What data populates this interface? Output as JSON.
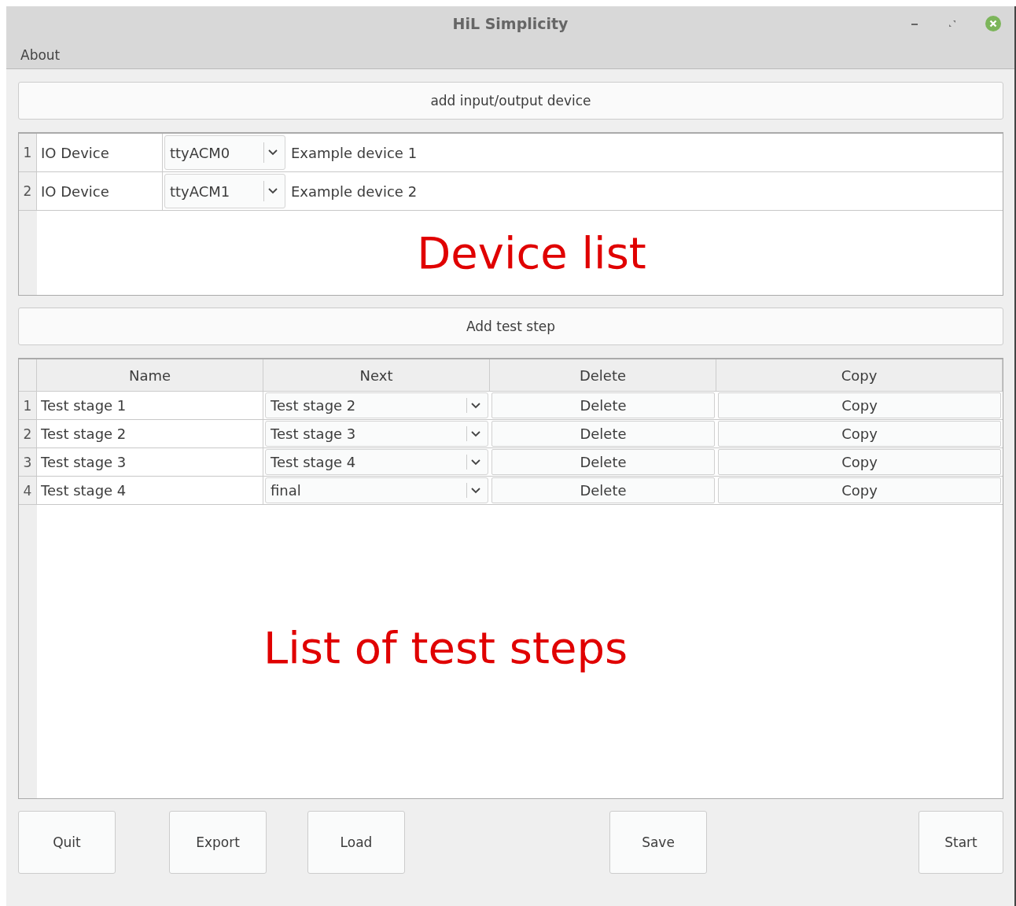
{
  "window": {
    "title": "HiL Simplicity"
  },
  "menu": [
    "About"
  ],
  "add_device_button": "add input/output device",
  "devices": [
    {
      "number": "1",
      "type": "IO Device",
      "port": "ttyACM0",
      "description": "Example device 1"
    },
    {
      "number": "2",
      "type": "IO Device",
      "port": "ttyACM1",
      "description": "Example device 2"
    }
  ],
  "device_list_annotation": "Device list",
  "add_step_button": "Add test step",
  "steps_table": {
    "columns": [
      "Name",
      "Next",
      "Delete",
      "Copy"
    ],
    "rows": [
      {
        "number": "1",
        "name": "Test stage 1",
        "next": "Test stage 2",
        "delete": "Delete",
        "copy": "Copy"
      },
      {
        "number": "2",
        "name": "Test stage 2",
        "next": "Test stage 3",
        "delete": "Delete",
        "copy": "Copy"
      },
      {
        "number": "3",
        "name": "Test stage 3",
        "next": "Test stage 4",
        "delete": "Delete",
        "copy": "Copy"
      },
      {
        "number": "4",
        "name": "Test stage 4",
        "next": "final",
        "delete": "Delete",
        "copy": "Copy"
      }
    ]
  },
  "steps_annotation": "List of test steps",
  "bottom_buttons": [
    "Quit",
    "Export",
    "Load",
    "Save",
    "Start"
  ]
}
